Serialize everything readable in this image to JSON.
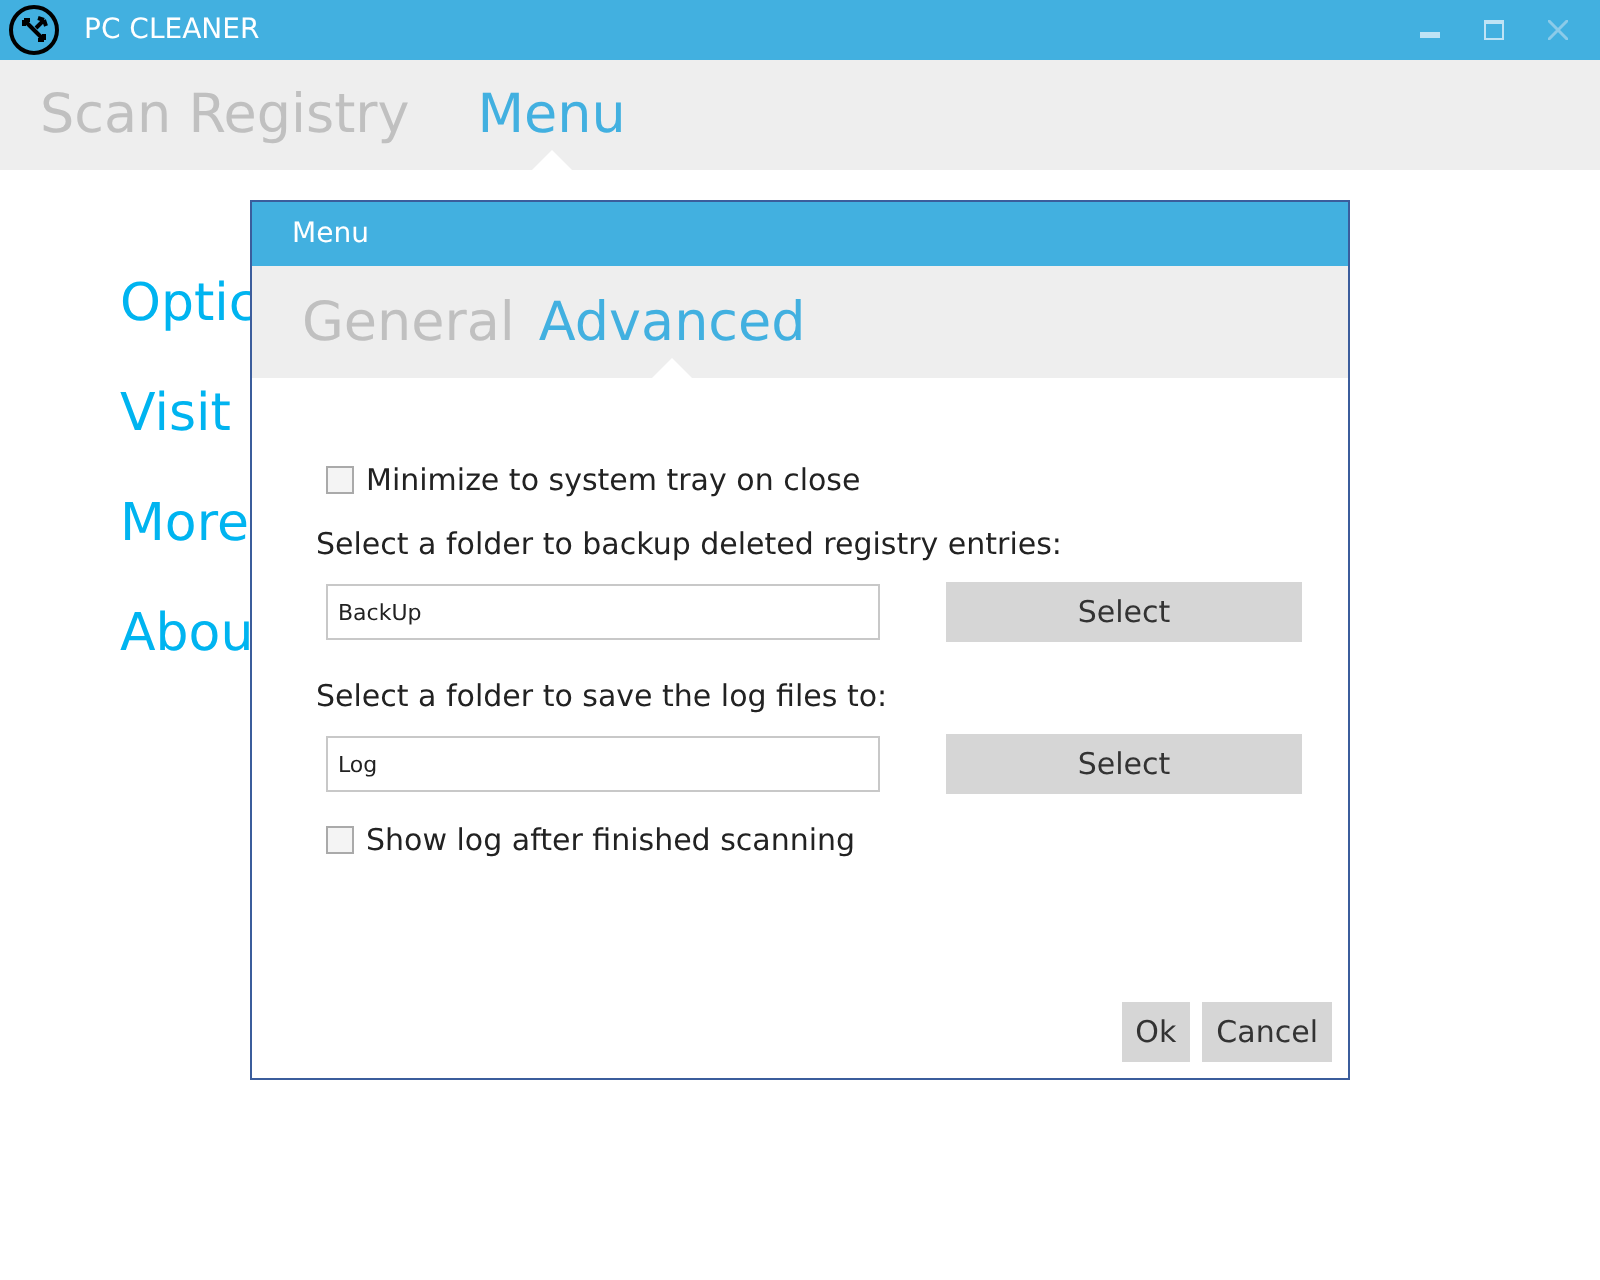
{
  "window": {
    "title": "PC CLEANER"
  },
  "tabs": [
    {
      "label": "Scan Registry",
      "selected": false
    },
    {
      "label": "Menu",
      "selected": true
    }
  ],
  "menu_items": [
    "Optic",
    "Visit",
    "More",
    "Abou"
  ],
  "dialog": {
    "title": "Menu",
    "tabs": [
      {
        "label": "General",
        "selected": false
      },
      {
        "label": "Advanced",
        "selected": true
      }
    ],
    "options": [
      {
        "kind": "checkbox",
        "label": "Minimize to system tray on close",
        "checked": false
      },
      {
        "kind": "folder",
        "label": "Select a folder to backup deleted registry entries:",
        "value": "BackUp",
        "button": "Select"
      },
      {
        "kind": "folder",
        "label": "Select a folder to save the log files to:",
        "value": "Log",
        "button": "Select"
      },
      {
        "kind": "checkbox",
        "label": "Show log after finished scanning",
        "checked": false
      }
    ],
    "buttons": [
      "Ok",
      "Cancel"
    ]
  }
}
